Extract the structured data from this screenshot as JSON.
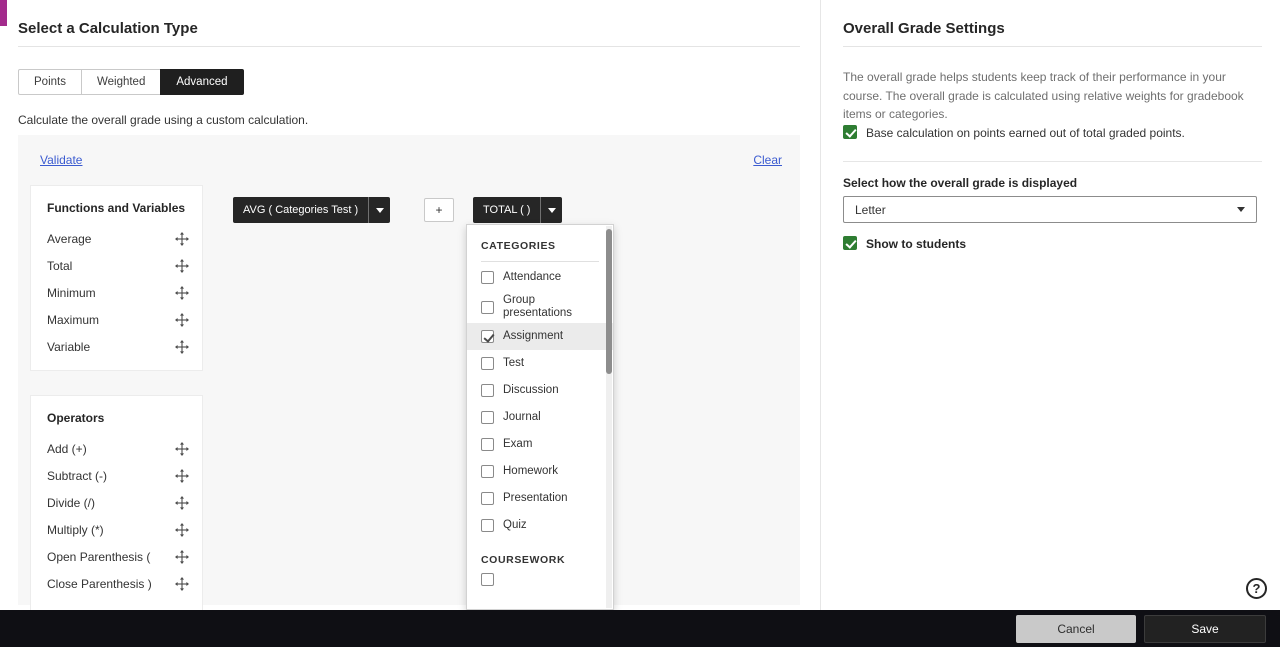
{
  "colors": {
    "accent": "#A32B8C",
    "checkbox_green": "#2E7D32",
    "link": "#3B5BD0",
    "chip_bg": "#262626",
    "footer_bg": "#0F0F14",
    "save_button_bg": "#222222",
    "cancel_button_bg": "#C9C9C9"
  },
  "left": {
    "title": "Select a Calculation Type",
    "tabs": [
      {
        "label": "Points",
        "active": false
      },
      {
        "label": "Weighted",
        "active": false
      },
      {
        "label": "Advanced",
        "active": true
      }
    ],
    "description": "Calculate the overall grade using a custom calculation.",
    "validate_label": "Validate",
    "clear_label": "Clear",
    "functions_panel": {
      "title": "Functions and Variables",
      "items": [
        "Average",
        "Total",
        "Minimum",
        "Maximum",
        "Variable"
      ]
    },
    "operators_panel": {
      "title": "Operators",
      "items": [
        "Add (+)",
        "Subtract (-)",
        "Divide (/)",
        "Multiply (*)",
        "Open Parenthesis (",
        "Close Parenthesis )"
      ]
    },
    "expression": {
      "avg_chip": "AVG ( Categories Test )",
      "plus_chip": "+",
      "total_chip": "TOTAL ( )"
    },
    "dropdown": {
      "sections": [
        {
          "header": "CATEGORIES",
          "divider": true,
          "items": [
            {
              "label": "Attendance",
              "checked": false
            },
            {
              "label": "Group presentations",
              "checked": false
            },
            {
              "label": "Assignment",
              "checked": true,
              "highlight": true
            },
            {
              "label": "Test",
              "checked": false
            },
            {
              "label": "Discussion",
              "checked": false
            },
            {
              "label": "Journal",
              "checked": false
            },
            {
              "label": "Exam",
              "checked": false
            },
            {
              "label": "Homework",
              "checked": false
            },
            {
              "label": "Presentation",
              "checked": false
            },
            {
              "label": "Quiz",
              "checked": false
            }
          ]
        },
        {
          "header": "COURSEWORK",
          "divider": false,
          "items": [
            {
              "label": "",
              "checked": false
            }
          ]
        }
      ]
    }
  },
  "right": {
    "title": "Overall Grade Settings",
    "description": "The overall grade helps students keep track of their performance in your course. The overall grade is calculated using relative weights for gradebook items or categories.",
    "base_calc_label": "Base calculation on points earned out of total graded points.",
    "display_label": "Select how the overall grade is displayed",
    "display_value": "Letter",
    "show_label": "Show to students"
  },
  "footer": {
    "cancel_label": "Cancel",
    "save_label": "Save"
  },
  "help": {
    "glyph": "?"
  }
}
